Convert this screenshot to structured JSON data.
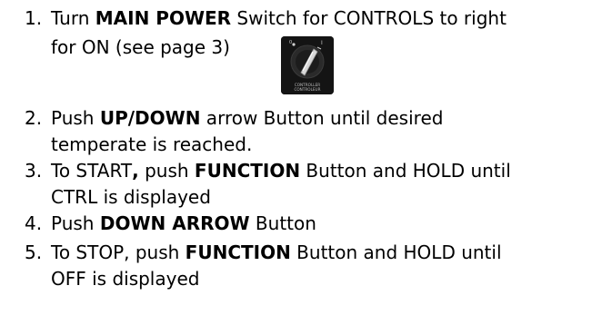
{
  "steps": [
    {
      "number": "1.",
      "line1": {
        "pre": "Turn ",
        "bold": "MAIN POWER",
        "post": " Switch for CONTROLS to right"
      },
      "line2": "for ON (see page 3)"
    },
    {
      "number": "2.",
      "line1": {
        "pre": "Push ",
        "bold": "UP/DOWN",
        "post": " arrow Button until desired"
      },
      "line2": "temperate is reached."
    },
    {
      "number": "3.",
      "line1": {
        "pre": "To START",
        "bold": ",",
        "mid": " push ",
        "bold2": "FUNCTION",
        "post": " Button and HOLD until"
      },
      "line2": "CTRL is displayed"
    },
    {
      "number": "4.",
      "line1": {
        "pre": "Push ",
        "bold": "DOWN ARROW",
        "post": " Button"
      }
    },
    {
      "number": "5.",
      "line1": {
        "pre": "To STOP, push ",
        "bold": "FUNCTION",
        "post": " Button and HOLD until"
      },
      "line2": "OFF is displayed"
    }
  ],
  "switch_image": {
    "label_top": "CONTROLLER",
    "label_bottom": "CONTROLEUR",
    "icon": "rotary-switch-icon",
    "marks": [
      "0",
      "I"
    ]
  }
}
